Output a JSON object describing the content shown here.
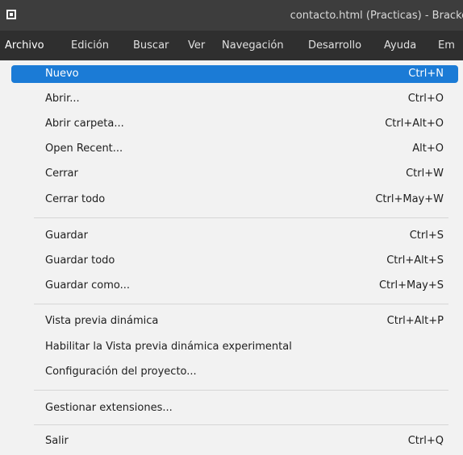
{
  "window": {
    "title": "contacto.html (Practicas) - Brackets"
  },
  "menubar": {
    "items": [
      "Archivo",
      "Edición",
      "Buscar",
      "Ver",
      "Navegación",
      "Desarrollo",
      "Ayuda",
      "Em"
    ]
  },
  "menu": {
    "items": [
      {
        "label": "Nuevo",
        "shortcut": "Ctrl+N",
        "selected": true
      },
      {
        "label": "Abrir...",
        "shortcut": "Ctrl+O"
      },
      {
        "label": "Abrir carpeta...",
        "shortcut": "Ctrl+Alt+O"
      },
      {
        "label": "Open Recent...",
        "shortcut": "Alt+O"
      },
      {
        "label": "Cerrar",
        "shortcut": "Ctrl+W"
      },
      {
        "label": "Cerrar todo",
        "shortcut": "Ctrl+May+W"
      },
      {
        "label": "Guardar",
        "shortcut": "Ctrl+S"
      },
      {
        "label": "Guardar todo",
        "shortcut": "Ctrl+Alt+S"
      },
      {
        "label": "Guardar como...",
        "shortcut": "Ctrl+May+S"
      },
      {
        "label": "Vista previa dinámica",
        "shortcut": "Ctrl+Alt+P"
      },
      {
        "label": "Habilitar la Vista previa dinámica experimental",
        "shortcut": ""
      },
      {
        "label": "Configuración del proyecto...",
        "shortcut": ""
      },
      {
        "label": "Gestionar extensiones...",
        "shortcut": ""
      },
      {
        "label": "Salir",
        "shortcut": "Ctrl+Q"
      }
    ]
  },
  "colors": {
    "selection": "#1b7bd6",
    "menubar": "#2f2f2f",
    "titlebar": "#3d3d3d"
  }
}
